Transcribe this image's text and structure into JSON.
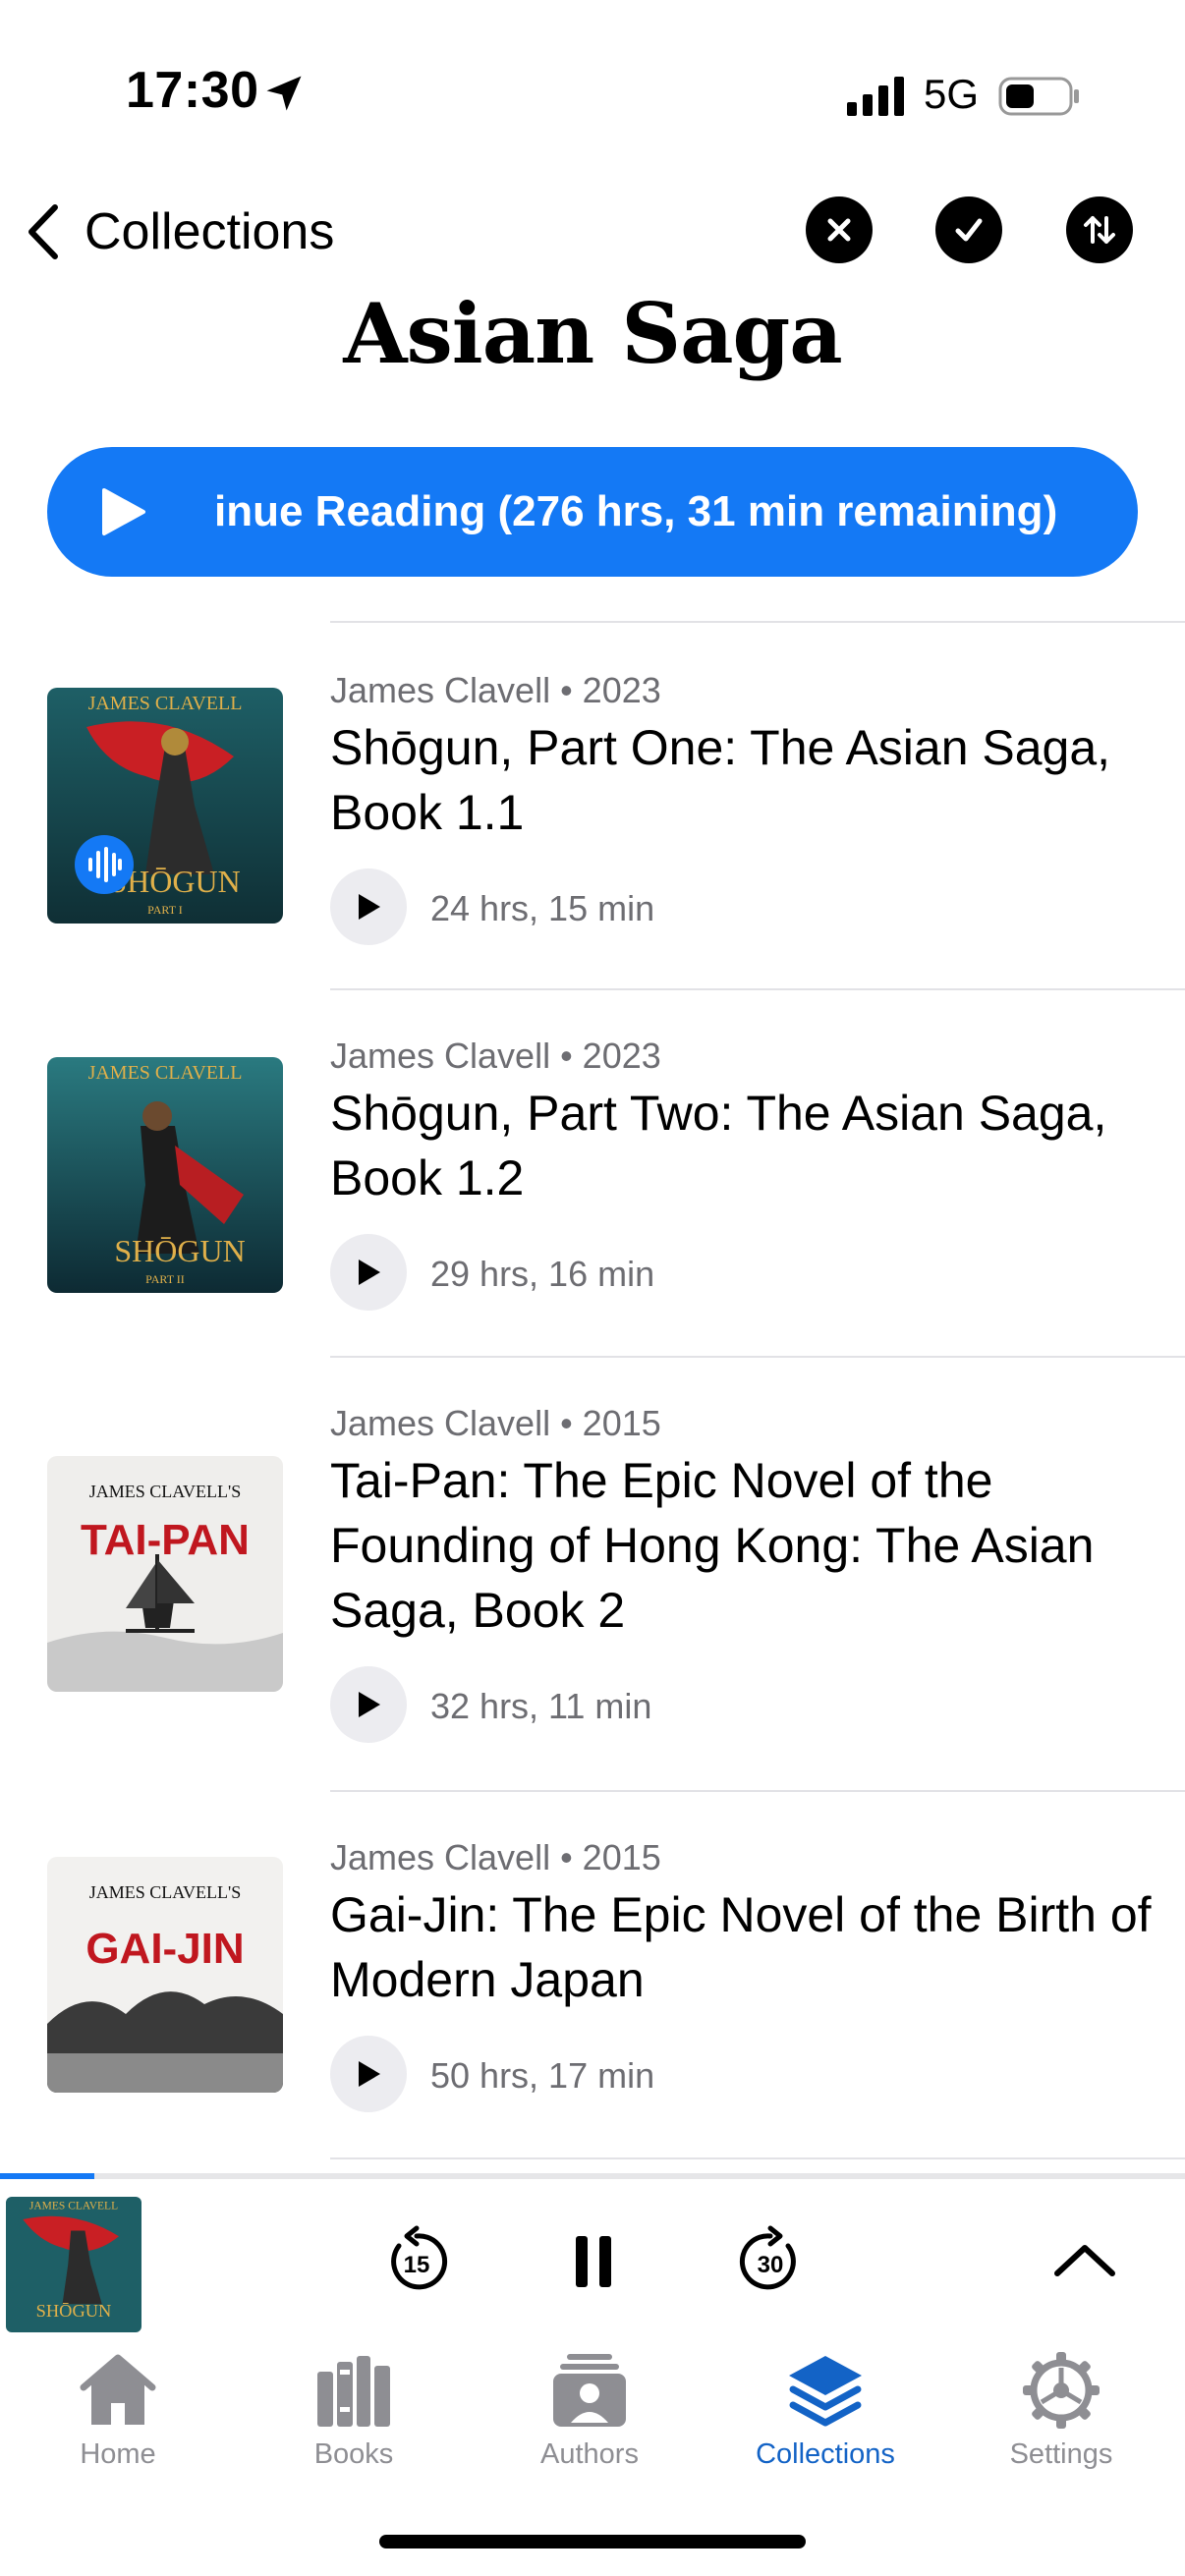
{
  "status_bar": {
    "time": "17:30",
    "network": "5G"
  },
  "nav": {
    "back_label": "Collections"
  },
  "page": {
    "title": "Asian Saga"
  },
  "continue_button": {
    "label": "inue Reading (276 hrs, 31 min remaining)"
  },
  "books": [
    {
      "author_year": "James Clavell • 2023",
      "title": "Shōgun, Part One: The Asian Saga, Book 1.1",
      "duration": "24 hrs, 15 min",
      "cover_author": "JAMES CLAVELL",
      "cover_title": "SHŌGUN",
      "cover_part": "PART I"
    },
    {
      "author_year": "James Clavell • 2023",
      "title": "Shōgun, Part Two: The Asian Saga, Book 1.2",
      "duration": "29 hrs, 16 min",
      "cover_author": "JAMES CLAVELL",
      "cover_title": "SHŌGUN",
      "cover_part": "PART II"
    },
    {
      "author_year": "James Clavell • 2015",
      "title": "Tai-Pan: The Epic Novel of the Founding of Hong Kong: The Asian Saga, Book 2",
      "duration": "32 hrs, 11 min",
      "cover_author": "JAMES CLAVELL'S",
      "cover_title": "TAI-PAN"
    },
    {
      "author_year": "James Clavell • 2015",
      "title": "Gai-Jin: The Epic Novel of the Birth of Modern Japan",
      "duration": "50 hrs, 17 min",
      "cover_author": "JAMES CLAVELL'S",
      "cover_title": "GAI-JIN"
    }
  ],
  "player": {
    "skip_back_seconds": "15",
    "skip_forward_seconds": "30",
    "progress_fraction": 0.08
  },
  "tabs": [
    {
      "label": "Home",
      "icon": "house-icon",
      "active": false
    },
    {
      "label": "Books",
      "icon": "books-icon",
      "active": false
    },
    {
      "label": "Authors",
      "icon": "person-card-icon",
      "active": false
    },
    {
      "label": "Collections",
      "icon": "stack-icon",
      "active": true
    },
    {
      "label": "Settings",
      "icon": "gear-icon",
      "active": false
    }
  ],
  "colors": {
    "accent": "#1479f5",
    "tab_active": "#1363c6",
    "tab_inactive": "#8e8e93"
  }
}
